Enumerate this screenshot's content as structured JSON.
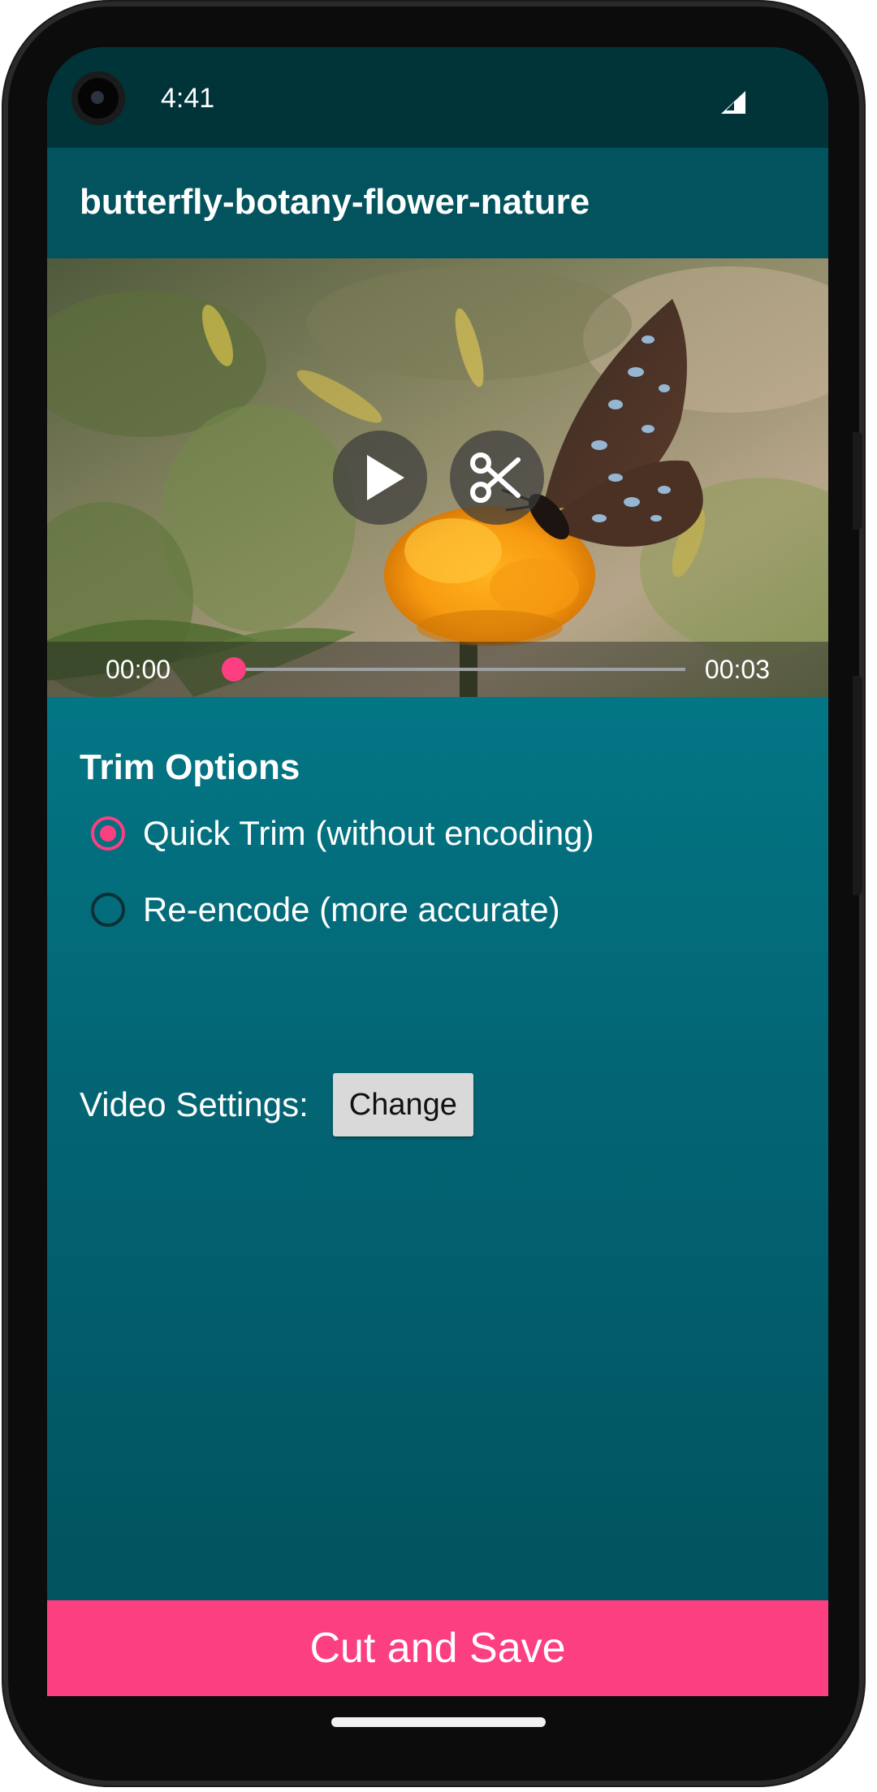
{
  "status_bar": {
    "time": "4:41"
  },
  "app_bar": {
    "title": "butterfly-botany-flower-nature"
  },
  "player": {
    "current_time": "00:00",
    "total_time": "00:03",
    "progress_fraction": 0.0,
    "controls": [
      "play-icon",
      "scissors-icon"
    ]
  },
  "trim": {
    "section_title": "Trim Options",
    "options": [
      {
        "label": "Quick Trim (without encoding)",
        "selected": true
      },
      {
        "label": "Re-encode (more accurate)",
        "selected": false
      }
    ]
  },
  "video_settings": {
    "label": "Video Settings:",
    "button_label": "Change"
  },
  "action": {
    "label": "Cut and Save"
  },
  "colors": {
    "accent": "#fc3f81",
    "app_bar": "#02535d",
    "content": "#037685",
    "status_bar": "#013439"
  }
}
